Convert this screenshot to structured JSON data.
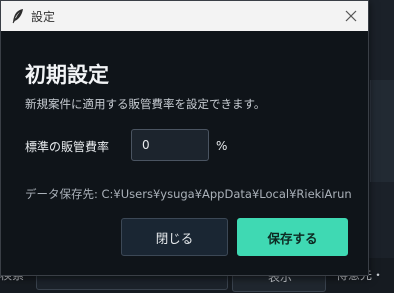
{
  "background": {
    "search_label": "検索",
    "show_button_label": "表示",
    "client_label": "得意先・"
  },
  "dialog": {
    "title": "設定",
    "heading": "初期設定",
    "description": "新規案件に適用する販管費率を設定できます。",
    "rate": {
      "label": "標準の販管費率",
      "value": "0",
      "unit": "%"
    },
    "data_path": "データ保存先: C:¥Users¥ysuga¥AppData¥Local¥RiekiArun",
    "buttons": {
      "close_label": "閉じる",
      "save_label": "保存する"
    }
  },
  "colors": {
    "accent": "#3fd9b3",
    "dialog_bg": "#0f1419",
    "titlebar_bg": "#f3f3f3"
  },
  "icons": {
    "title": "feather-icon",
    "close": "close-icon"
  }
}
